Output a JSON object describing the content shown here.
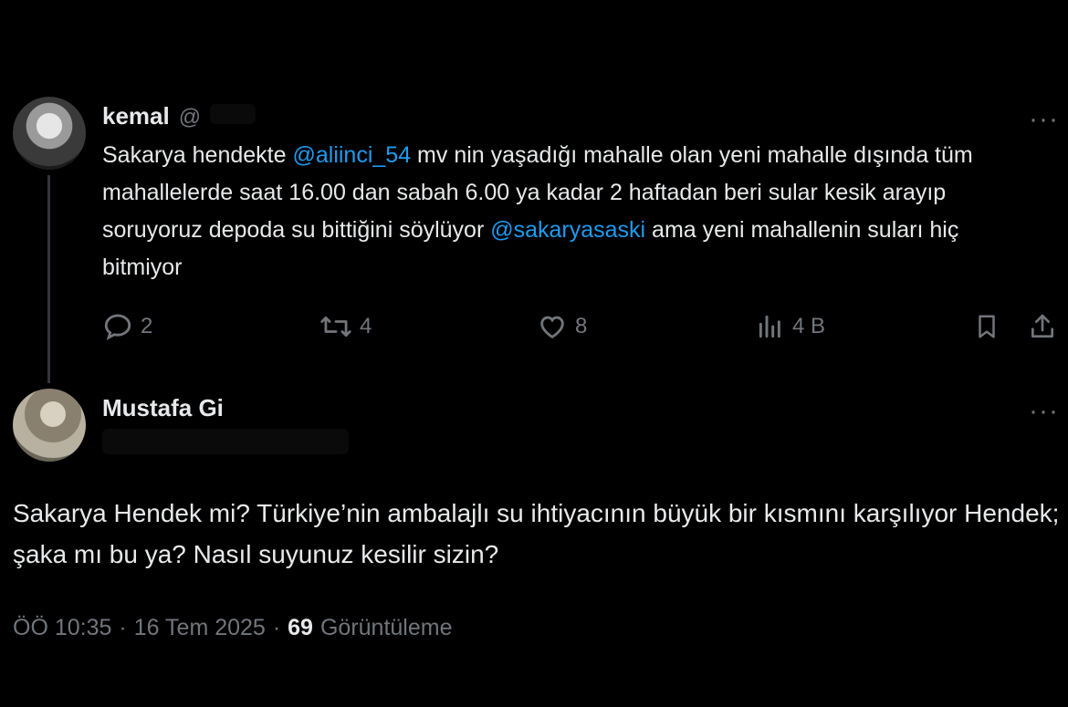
{
  "reply_to": {
    "name": "kemal",
    "handle": "@",
    "more": "···",
    "text_parts": [
      {
        "t": "Sakarya hendekte ",
        "mention": false
      },
      {
        "t": "@aliinci_54",
        "mention": true
      },
      {
        "t": " mv nin yaşadığı mahalle olan yeni mahalle dışında tüm mahallelerde saat 16.00 dan sabah 6.00 ya kadar 2 haftadan beri sular kesik arayıp soruyoruz depoda su bittiğini söylüyor ",
        "mention": false
      },
      {
        "t": "@sakaryasaski",
        "mention": true
      },
      {
        "t": " ama yeni mahallenin suları hiç bitmiyor",
        "mention": false
      }
    ],
    "actions": {
      "replies": "2",
      "retweets": "4",
      "likes": "8",
      "views": "4 B"
    },
    "icons": [
      "reply-icon",
      "retweet-icon",
      "like-icon",
      "views-icon",
      "bookmark-icon",
      "share-icon"
    ]
  },
  "main_tweet": {
    "name": "Mustafa Gi",
    "more": "···",
    "text": "Sakarya Hendek mi? Türkiye’nin ambalajlı su ihtiyacının büyük bir kısmını karşılıyor Hendek; şaka mı bu ya? Nasıl suyunuz kesilir sizin?",
    "time": "ÖÖ 10:35",
    "date": "16 Tem 2025",
    "separator": "·",
    "views_count": "69",
    "views_label": "Görüntüleme"
  },
  "colors": {
    "background": "#000000",
    "text": "#e7e9ea",
    "secondary": "#71767b",
    "mention": "#1d9bf0"
  }
}
